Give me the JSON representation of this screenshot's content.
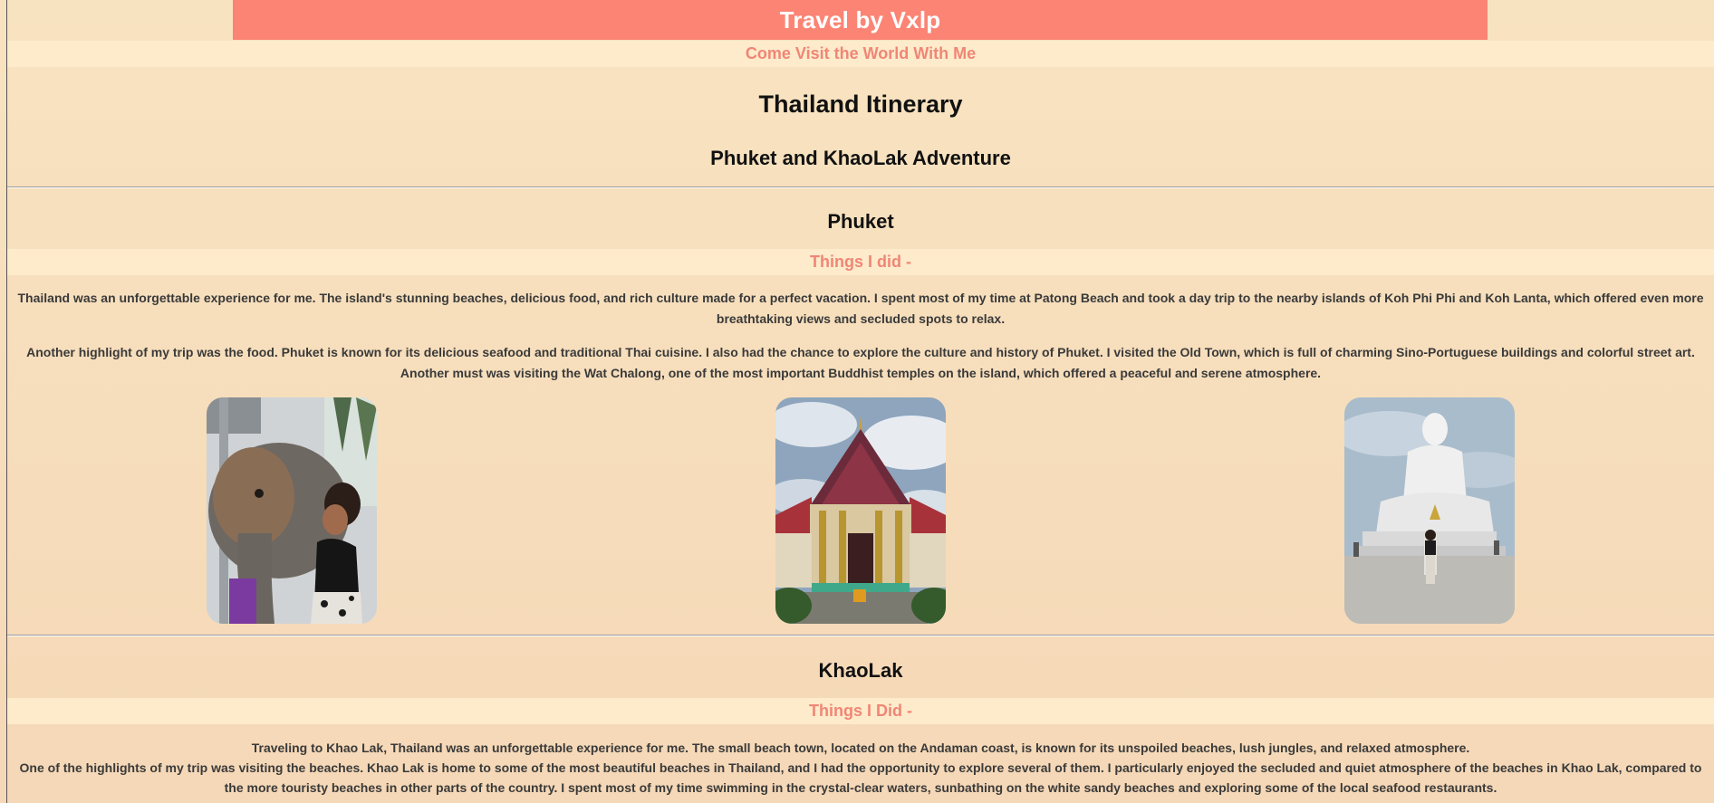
{
  "header": {
    "site_title": "Travel by Vxlp",
    "tagline": "Come Visit the World With Me"
  },
  "page": {
    "title": "Thailand Itinerary",
    "subtitle": "Phuket and KhaoLak Adventure"
  },
  "sections": [
    {
      "heading": "Phuket",
      "band_label": "Things I did -",
      "paragraphs": [
        "Thailand was an unforgettable experience for me. The island's stunning beaches, delicious food, and rich culture made for a perfect vacation. I spent most of my time at Patong Beach and took a day trip to the nearby islands of Koh Phi Phi and Koh Lanta, which offered even more breathtaking views and secluded spots to relax.",
        "Another highlight of my trip was the food. Phuket is known for its delicious seafood and traditional Thai cuisine. I also had the chance to explore the culture and history of Phuket. I visited the Old Town, which is full of charming Sino-Portuguese buildings and colorful street art. Another must was visiting the Wat Chalong, one of the most important Buddhist temples on the island, which offered a peaceful and serene atmosphere."
      ],
      "photos": [
        {
          "subject": "elephant-photo"
        },
        {
          "subject": "temple-photo"
        },
        {
          "subject": "big-buddha-photo"
        }
      ]
    },
    {
      "heading": "KhaoLak",
      "band_label": "Things I Did -",
      "paragraphs": [
        "Traveling to Khao Lak, Thailand was an unforgettable experience for me. The small beach town, located on the Andaman coast, is known for its unspoiled beaches, lush jungles, and relaxed atmosphere.",
        "One of the highlights of my trip was visiting the beaches. Khao Lak is home to some of the most beautiful beaches in Thailand, and I had the opportunity to explore several of them. I particularly enjoyed the secluded and quiet atmosphere of the beaches in Khao Lak, compared to the more touristy beaches in other parts of the country. I spent most of my time swimming in the crystal-clear waters, sunbathing on the white sandy beaches and exploring some of the local seafood restaurants."
      ]
    }
  ],
  "colors": {
    "header_bg": "#fc8474",
    "band_bg": "#fdebcb",
    "accent_text": "#f08676",
    "page_bg": "#f8e3c0"
  }
}
